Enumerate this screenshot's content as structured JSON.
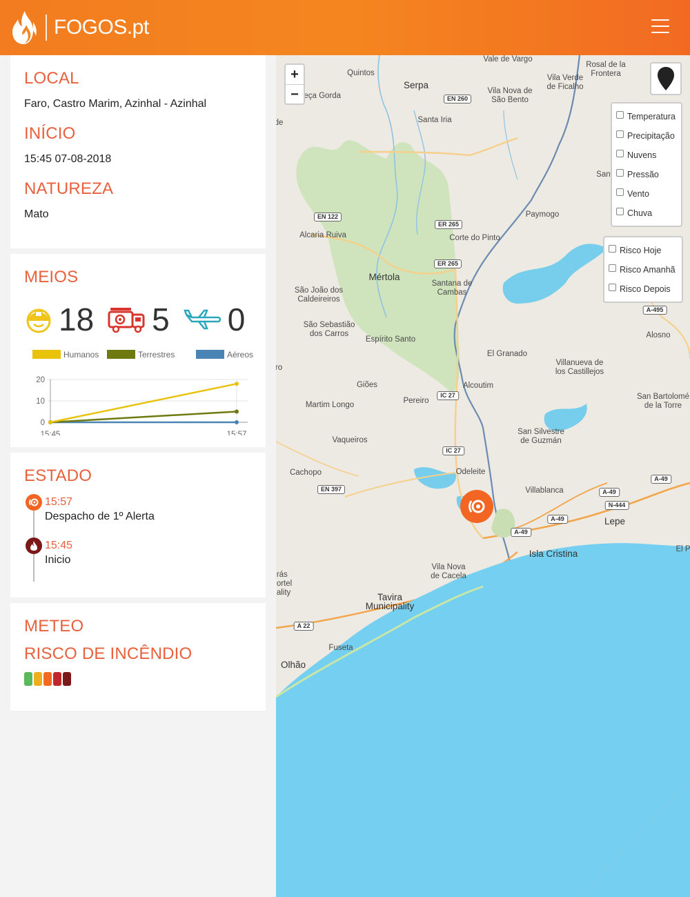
{
  "header": {
    "brand": "FOGOS.pt",
    "menu_icon": "hamburger-menu-icon"
  },
  "info": {
    "local_label": "LOCAL",
    "local_value": "Faro, Castro Marim, Azinhal - Azinhal",
    "inicio_label": "INÍCIO",
    "inicio_value": "15:45 07-08-2018",
    "natureza_label": "NATUREZA",
    "natureza_value": "Mato"
  },
  "meios": {
    "title": "MEIOS",
    "humanos": "18",
    "terrestres": "5",
    "aereos": "0"
  },
  "chart_data": {
    "type": "line",
    "x": [
      "15:45",
      "15:57"
    ],
    "series": [
      {
        "name": "Humanos",
        "values": [
          0,
          18
        ],
        "color": "#e8c20b"
      },
      {
        "name": "Terrestres",
        "values": [
          0,
          5
        ],
        "color": "#6e7a10"
      },
      {
        "name": "Aéreos",
        "values": [
          0,
          0
        ],
        "color": "#4a84b4"
      }
    ],
    "ylim": [
      0,
      20
    ],
    "yticks": [
      "0",
      "10",
      "20"
    ],
    "legend": "top",
    "grid": true
  },
  "estado": {
    "title": "ESTADO",
    "events": [
      {
        "time": "15:57",
        "desc": "Despacho de 1º Alerta",
        "color": "#f26522"
      },
      {
        "time": "15:45",
        "desc": "Inicio",
        "color": "#7b1818"
      }
    ]
  },
  "meteo": {
    "title": "METEO",
    "risco_title": "RISCO DE INCÊNDIO",
    "risk_colors": [
      "#5cb85c",
      "#f0ad1f",
      "#f26a22",
      "#c0272d",
      "#7b1818"
    ]
  },
  "map": {
    "zoom_in": "+",
    "zoom_out": "−",
    "weather_layers": [
      "Temperatura",
      "Precipitação",
      "Nuvens",
      "Pressão",
      "Vento",
      "Chuva"
    ],
    "risk_layers": [
      "Risco Hoje",
      "Risco Amanhã",
      "Risco Depois"
    ],
    "places": {
      "quintos": "Quintos",
      "serpa": "Serpa",
      "vale_vargo": "Vale de Vargo",
      "vila_verde": "Vila Verde\nde Ficalho",
      "rosal": "Rosal de la\nFrontera",
      "beca_gorda": "beça Gorda",
      "vila_nova_sb": "Vila Nova de\nSão Bento",
      "santa_iria": "Santa Iria",
      "sant": "Sant",
      "paymogo": "Paymogo",
      "alcaria_ruiva": "Alcaria Ruiva",
      "corte_pinto": "Corte do Pinto",
      "mertola": "Mértola",
      "santana": "Santana de\nCambas",
      "sao_joao": "São João dos\nCaldeireiros",
      "sao_sebastiao": "São Sebastião\ndos Carros",
      "espirito_santo": "Espírito Santo",
      "alosno": "Alosno",
      "el_granado": "El Granado",
      "villanueva": "Villanueva de\nlos Castillejos",
      "gioes": "Giões",
      "alcoutim": "Alcoutim",
      "martim_longo": "Martim Longo",
      "pereiro": "Pereiro",
      "san_bartolome": "San Bartolomé\nde la Torre",
      "vaqueiros": "Vaqueiros",
      "san_silvestre": "San Silvestre\nde Guzmán",
      "cachopo": "Cachopo",
      "odeleite": "Odeleite",
      "villablanca": "Villablanca",
      "lepe": "Lepe",
      "isla_cristina": "Isla Cristina",
      "el_p": "El P",
      "vila_nova_cacela": "Vila Nova\nde Cacela",
      "tavira": "Tavira\nMunicipality",
      "fuseta": "Fuseta",
      "olhao": "Olhão",
      "tras": "rás\nortel\nality",
      "de": "de",
      "ro": "ro"
    },
    "roads": {
      "en260": "EN 260",
      "en122": "EN 122",
      "er265a": "ER 265",
      "er265b": "ER 265",
      "a495": "A-495",
      "ic27a": "IC 27",
      "ic27b": "IC 27",
      "en397": "EN 397",
      "a49a": "A-49",
      "a49b": "A-49",
      "a49c": "A-49",
      "a49d": "A-49",
      "n444": "N-444",
      "a22": "A 22"
    }
  }
}
